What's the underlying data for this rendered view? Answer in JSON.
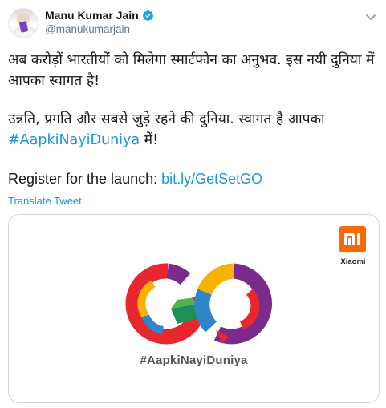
{
  "header": {
    "display_name": "Manu Kumar Jain",
    "handle": "@manukumarjain"
  },
  "tweet": {
    "paragraph1": "अब करोड़ों भारतीयों को मिलेगा स्मार्टफोन का अनुभव. इस नयी दुनिया में आपका स्वागत है!",
    "paragraph2_text": "उन्नति, प्रगति और सबसे जुड़े रहने की दुनिया. स्वागत है आपका",
    "paragraph2_hashtag": "#AapkiNayiDuniya",
    "paragraph2_suffix": " में!",
    "register_text": "Register for the launch: ",
    "register_link": "bit.ly/GetSetGO"
  },
  "translate_label": "Translate Tweet",
  "card": {
    "brand_logo_text": "Xiaomi",
    "caption": "#AapkiNayiDuniya"
  },
  "colors": {
    "link": "#1b95e0",
    "xiaomi_orange": "#ff6700"
  },
  "icons": [
    "verified-badge-icon",
    "chevron-down-icon",
    "mi-logo-icon"
  ]
}
